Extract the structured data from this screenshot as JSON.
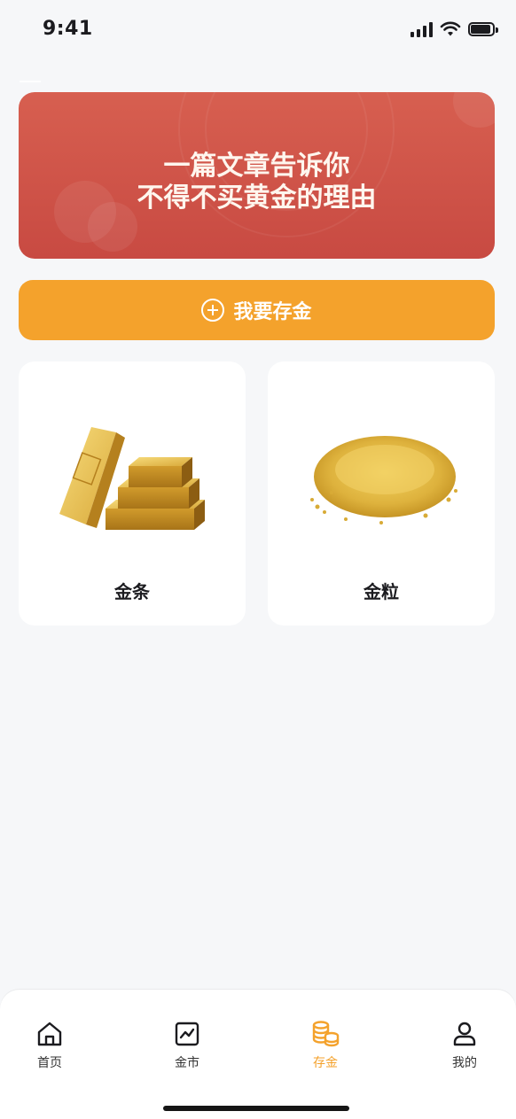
{
  "status_bar": {
    "time": "9:41"
  },
  "banner": {
    "line1": "一篇文章告诉你",
    "line2": "不得不买黄金的理由",
    "background_color": "#cf5448"
  },
  "deposit_button": {
    "label": "我要存金",
    "icon": "plus-circle-icon",
    "color": "#f4a22c"
  },
  "products": [
    {
      "label": "金条",
      "image": "gold-bars-image"
    },
    {
      "label": "金粒",
      "image": "gold-grains-image"
    }
  ],
  "tab_bar": {
    "active_color": "#f4a22c",
    "tabs": [
      {
        "label": "首页",
        "icon": "home-icon",
        "active": false
      },
      {
        "label": "金市",
        "icon": "chart-icon",
        "active": false
      },
      {
        "label": "存金",
        "icon": "coins-icon",
        "active": true
      },
      {
        "label": "我的",
        "icon": "user-icon",
        "active": false
      }
    ]
  }
}
